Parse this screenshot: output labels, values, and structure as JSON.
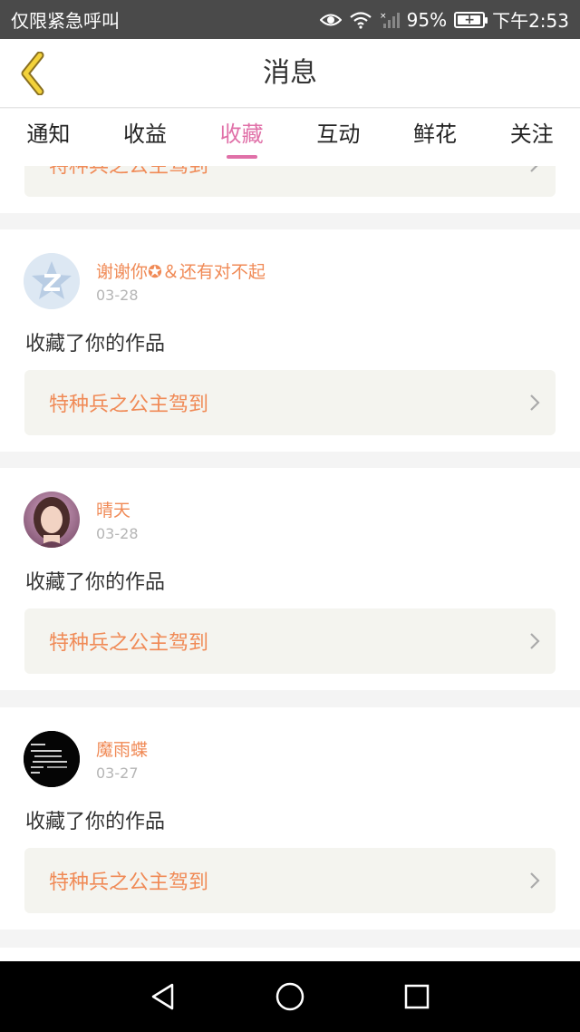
{
  "status_bar": {
    "carrier_text": "仅限紧急呼叫",
    "battery_percent": "95%",
    "battery_level": 0.95,
    "time": "下午2:53"
  },
  "header": {
    "title": "消息",
    "accent_color": "#f0c030"
  },
  "tabs": [
    {
      "label": "通知",
      "active": false
    },
    {
      "label": "收益",
      "active": false
    },
    {
      "label": "收藏",
      "active": true
    },
    {
      "label": "互动",
      "active": false
    },
    {
      "label": "鲜花",
      "active": false
    },
    {
      "label": "关注",
      "active": false
    }
  ],
  "active_color": "#e070a8",
  "partial_card": {
    "work_title": "特种兵之公主驾到"
  },
  "messages": [
    {
      "user": "谢谢你✪＆还有对不起",
      "date": "03-28",
      "action": "收藏了你的作品",
      "work_title": "特种兵之公主驾到",
      "avatar": "default-z-avatar"
    },
    {
      "user": "晴天",
      "date": "03-28",
      "action": "收藏了你的作品",
      "work_title": "特种兵之公主驾到",
      "avatar": "photo-avatar"
    },
    {
      "user": "魔雨蝶",
      "date": "03-27",
      "action": "收藏了你的作品",
      "work_title": "特种兵之公主驾到",
      "avatar": "dark-text-avatar"
    }
  ],
  "nav": {
    "back_icon": "triangle-back-icon",
    "home_icon": "circle-home-icon",
    "recents_icon": "square-recents-icon"
  }
}
